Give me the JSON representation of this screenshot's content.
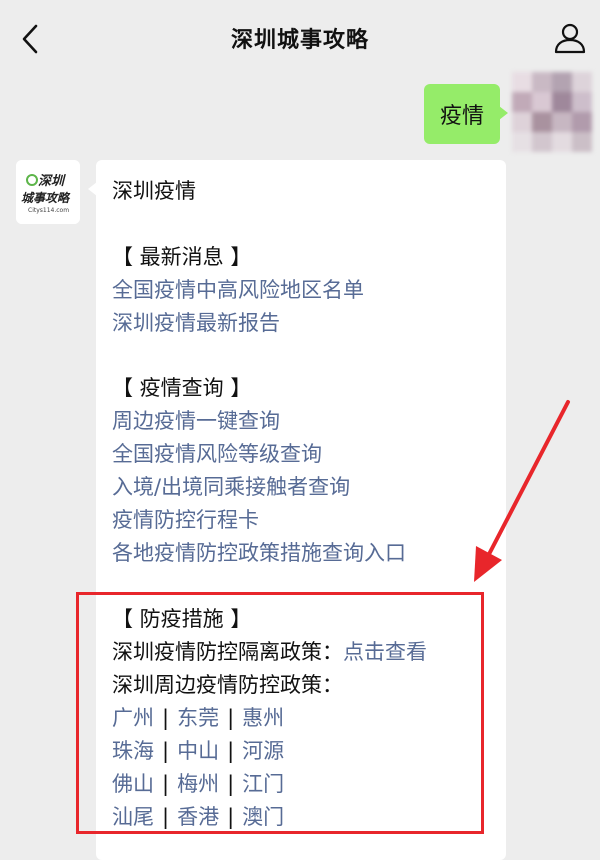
{
  "header": {
    "title": "深圳城事攻略",
    "back_icon": "chevron-left-icon",
    "profile_icon": "user-icon"
  },
  "outgoing": {
    "text": "疫情"
  },
  "bot": {
    "avatar_text_line1": "深圳",
    "avatar_text_line2": "城事攻略",
    "avatar_subtext": "Citys114.com"
  },
  "message": {
    "heading": "深圳疫情",
    "section1": {
      "title": "【 最新消息 】",
      "links": [
        "全国疫情中高风险地区名单",
        "深圳疫情最新报告"
      ]
    },
    "section2": {
      "title": "【 疫情查询 】",
      "links": [
        "周边疫情一键查询",
        "全国疫情风险等级查询",
        "入境/出境同乘接触者查询",
        "疫情防控行程卡",
        "各地疫情防控政策措施查询入口"
      ]
    },
    "section3": {
      "title": "【 防疫措施 】",
      "policy_label": "深圳疫情防控隔离政策：",
      "policy_link": "点击查看",
      "nearby_label": "深圳周边疫情防控政策：",
      "cities": [
        [
          "广州",
          "东莞",
          "惠州"
        ],
        [
          "珠海",
          "中山",
          "河源"
        ],
        [
          "佛山",
          "梅州",
          "江门"
        ],
        [
          "汕尾",
          "香港",
          "澳门"
        ]
      ],
      "separator": "|"
    }
  },
  "colors": {
    "link": "#576b95",
    "bubble_out": "#95ec69",
    "highlight": "#e8262b"
  }
}
